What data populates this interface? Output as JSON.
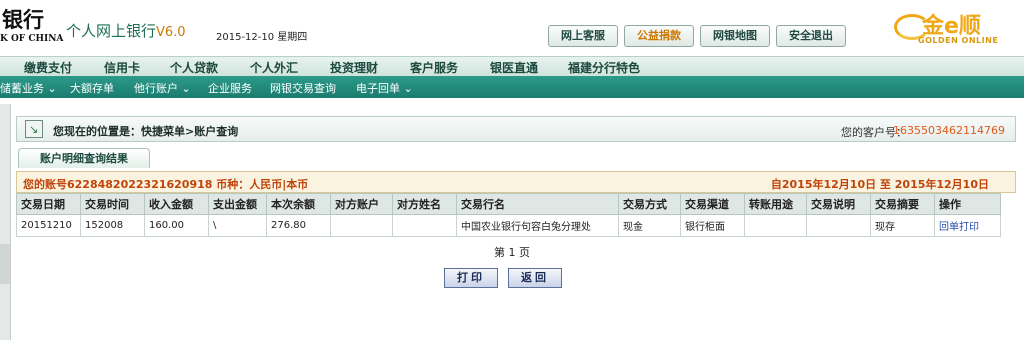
{
  "header": {
    "bank_name": "银行",
    "bank_name_en": "K OF CHINA",
    "app_title": "个人网上银行",
    "version": "V6.0",
    "date": "2015-12-10",
    "weekday": "星期四",
    "buttons": [
      "网上客服",
      "公益捐款",
      "网银地图",
      "安全退出"
    ],
    "partner_logo_text": "金e顺",
    "partner_logo_en": "GOLDEN ONLINE"
  },
  "nav_main": [
    "缴费支付",
    "信用卡",
    "个人贷款",
    "个人外汇",
    "投资理财",
    "客户服务",
    "银医直通",
    "福建分行特色"
  ],
  "nav_sub": [
    "储蓄业务 ⌄",
    "大额存单",
    "他行账户 ⌄",
    "企业服务",
    "网银交易查询",
    "电子回单 ⌄"
  ],
  "location": {
    "text": "您现在的位置是：快捷菜单>账户查询",
    "customer_label": "您的客户号：",
    "customer_no": "1635503462114769"
  },
  "result": {
    "tab_label": "账户明细查询结果",
    "account_text": "您的账号6228482022321620918 币种：人民币|本币",
    "date_range": "自2015年12月10日  至  2015年12月10日"
  },
  "table": {
    "headers": [
      "交易日期",
      "交易时间",
      "收入金额",
      "支出金额",
      "本次余额",
      "对方账户",
      "对方姓名",
      "交易行名",
      "交易方式",
      "交易渠道",
      "转账用途",
      "交易说明",
      "交易摘要",
      "操作"
    ],
    "rows": [
      [
        "20151210",
        "152008",
        "160.00",
        "\\",
        "276.80",
        "",
        "",
        "中国农业银行句容白兔分理处",
        "现金",
        "银行柜面",
        "",
        "",
        "现存",
        "回单打印"
      ]
    ]
  },
  "pagination": "第 1 页",
  "actions": {
    "print_label": "打印",
    "back_label": "返回"
  },
  "colors": {
    "teal_nav": "#1b7c6e",
    "accent_orange": "#c0440a",
    "customer_no": "#e0581a"
  }
}
